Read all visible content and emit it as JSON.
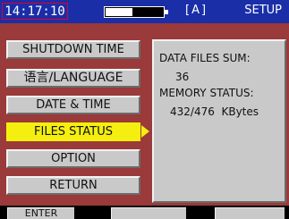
{
  "status": {
    "time": "14:17:10",
    "battery_level": 0.45,
    "channel": "[A]",
    "mode": "SETUP"
  },
  "menu": {
    "items": [
      {
        "label": "SHUTDOWN TIME"
      },
      {
        "label": "语言/LANGUAGE"
      },
      {
        "label": "DATE & TIME"
      },
      {
        "label": "FILES STATUS"
      },
      {
        "label": "OPTION"
      },
      {
        "label": "RETURN"
      }
    ],
    "selected_index": 3
  },
  "info_panel": {
    "data_files_label": "DATA FILES SUM:",
    "data_files_value": "36",
    "memory_label": "MEMORY STATUS:",
    "memory_value": "432/476  KBytes"
  },
  "softkeys": [
    {
      "label": "ENTER"
    },
    {
      "label": ""
    },
    {
      "label": ""
    },
    {
      "label": ""
    }
  ],
  "colors": {
    "status_bar": "#1a2ea8",
    "background": "#9a3a3a",
    "button_face": "#c9c9c9",
    "selected": "#f5ef10",
    "clock_border": "#e0002a"
  }
}
